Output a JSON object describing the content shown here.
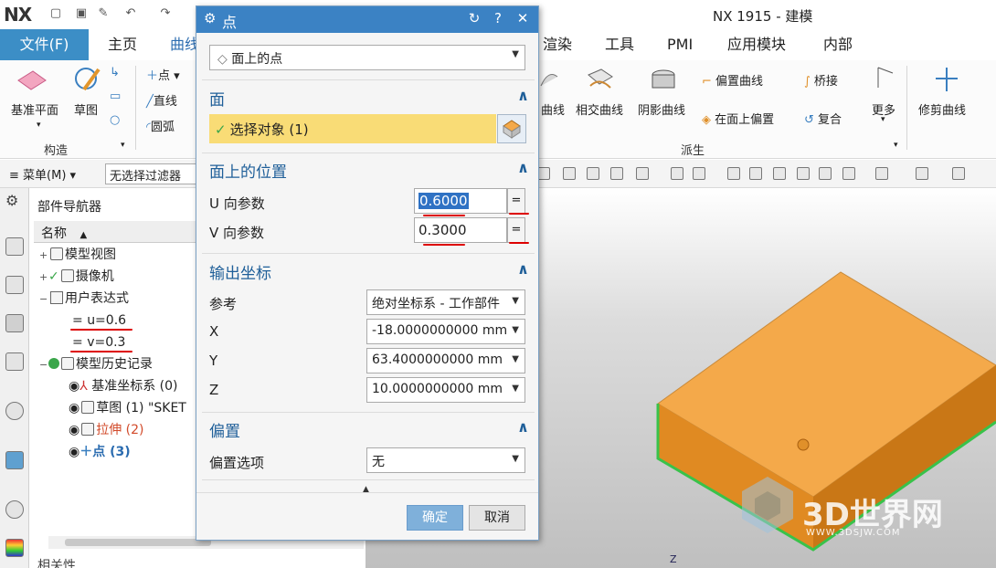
{
  "app": {
    "logo": "NX",
    "title": "NX 1915 - 建模"
  },
  "tabs": [
    "文件(F)",
    "主页",
    "曲线",
    "渲染",
    "工具",
    "PMI",
    "应用模块",
    "内部"
  ],
  "ribbon": {
    "datum_plane": "基准平面",
    "sketch": "草图",
    "point": "点",
    "line": "直线",
    "arc": "圆弧",
    "curve_on_face": "曲线",
    "intersect_curve": "相交曲线",
    "shadow_curve": "阴影曲线",
    "offset_curve": "偏置曲线",
    "offset_on_face": "在面上偏置",
    "bridge": "桥接",
    "composite": "复合",
    "more": "更多",
    "trim_curve": "修剪曲线",
    "group_construct": "构造",
    "group_derived": "派生"
  },
  "filterbar": {
    "menu": "菜单(M)",
    "filter": "无选择过滤器"
  },
  "navigator": {
    "title": "部件导航器",
    "col_name": "名称",
    "rows": [
      "模型视图",
      "摄像机",
      "用户表达式",
      "u=0.6",
      "v=0.3",
      "模型历史记录",
      "基准坐标系 (0)",
      "草图 (1) \"SKET",
      "拉伸 (2)",
      "点 (3)"
    ],
    "related": "相关性"
  },
  "dialog": {
    "title": "点",
    "type_value": "面上的点",
    "sec_face": "面",
    "select_object": "选择对象 (1)",
    "sec_position": "面上的位置",
    "u_label": "U 向参数",
    "u_value": "0.6000",
    "v_label": "V 向参数",
    "v_value": "0.3000",
    "eq": "=",
    "sec_output": "输出坐标",
    "ref_label": "参考",
    "ref_value": "绝对坐标系 - 工作部件",
    "x_label": "X",
    "x_value": "-18.0000000000 mm",
    "y_label": "Y",
    "y_value": "63.4000000000 mm",
    "z_label": "Z",
    "z_value": "10.0000000000 mm",
    "sec_offset": "偏置",
    "offset_label": "偏置选项",
    "offset_value": "无",
    "ok": "确定",
    "cancel": "取消"
  },
  "viewport": {
    "watermark": "3D世界网",
    "watermark_url": "WWW.3DSJW.COM",
    "axis": "Z"
  },
  "colors": {
    "accent": "#3b82c4",
    "file_tab": "#3c8ec6",
    "block_top": "#f4a94a",
    "block_side": "#e08a22",
    "edge": "#39c24a",
    "select_row": "#f9dc76"
  }
}
